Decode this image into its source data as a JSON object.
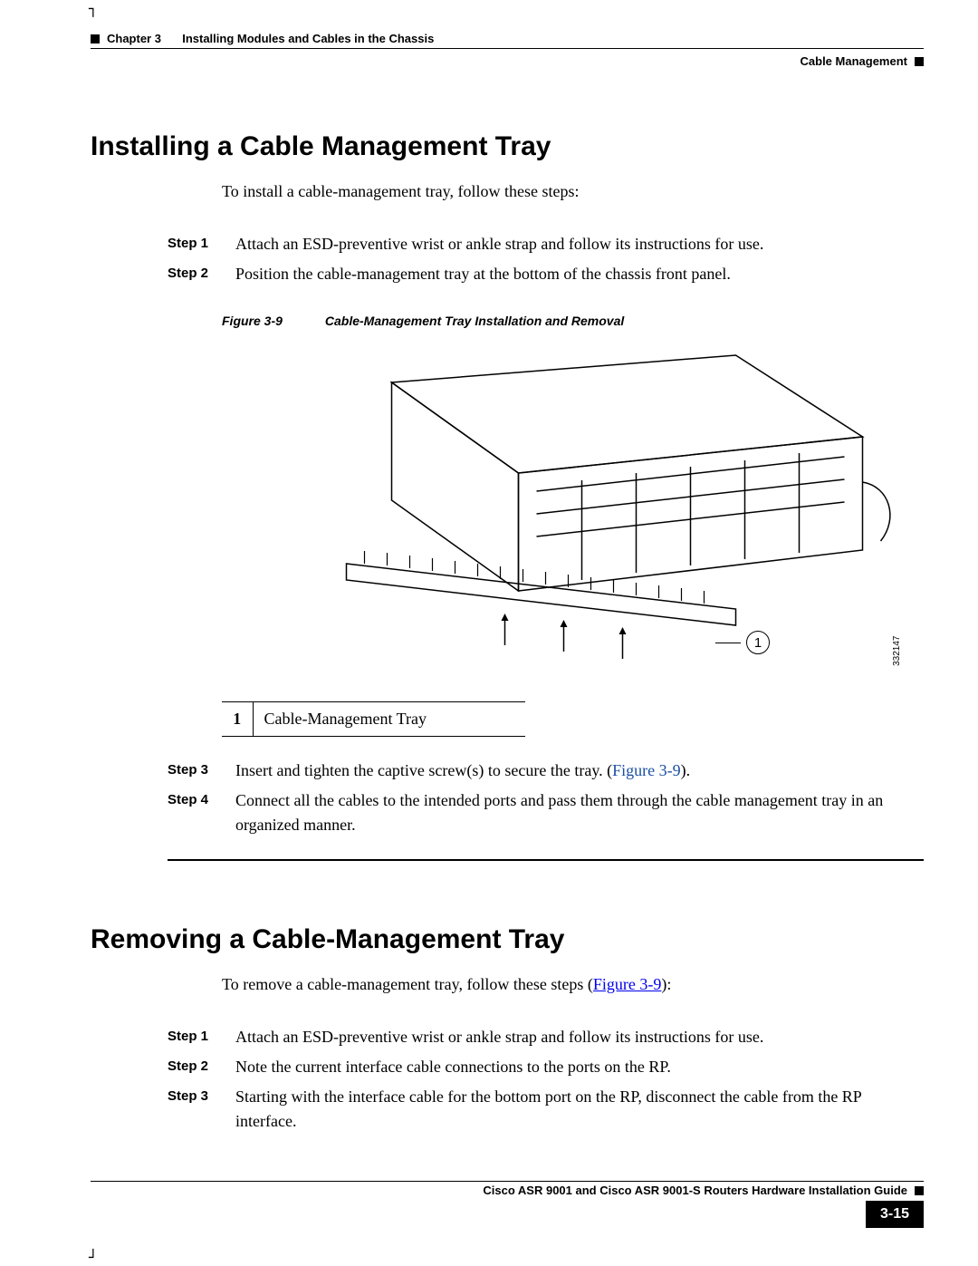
{
  "header": {
    "chapter_label": "Chapter 3",
    "chapter_title": "Installing Modules and Cables in the Chassis",
    "section_label": "Cable Management"
  },
  "sections": {
    "install": {
      "title": "Installing a Cable Management Tray",
      "intro": "To install a cable-management tray, follow these steps:",
      "steps": [
        {
          "label": "Step 1",
          "text": "Attach an ESD-preventive wrist or ankle strap and follow its instructions for use."
        },
        {
          "label": "Step 2",
          "text": "Position the cable-management tray at the bottom of the chassis front panel."
        },
        {
          "label": "Step 3",
          "text_pre": "Insert and tighten the captive screw(s) to secure the tray. (",
          "link": "Figure 3-9",
          "text_post": ")."
        },
        {
          "label": "Step 4",
          "text": "Connect all the cables to the intended ports and pass them through the cable management tray in an organized manner."
        }
      ]
    },
    "remove": {
      "title": "Removing a Cable-Management Tray",
      "intro_pre": "To remove a cable-management tray, follow these steps (",
      "intro_link": "Figure 3-9",
      "intro_post": "):",
      "steps": [
        {
          "label": "Step 1",
          "text": "Attach an ESD-preventive wrist or ankle strap and follow its instructions for use."
        },
        {
          "label": "Step 2",
          "text": "Note the current interface cable connections to the ports on the RP."
        },
        {
          "label": "Step 3",
          "text": "Starting with the interface cable for the bottom port on the RP, disconnect the cable from the RP interface."
        }
      ]
    }
  },
  "figure": {
    "label": "Figure 3-9",
    "title": "Cable-Management Tray Installation and Removal",
    "callout": "1",
    "image_id": "332147",
    "legend": {
      "num": "1",
      "text": "Cable-Management Tray"
    }
  },
  "footer": {
    "guide": "Cisco ASR 9001 and Cisco ASR 9001-S Routers Hardware Installation Guide",
    "page": "3-15"
  }
}
